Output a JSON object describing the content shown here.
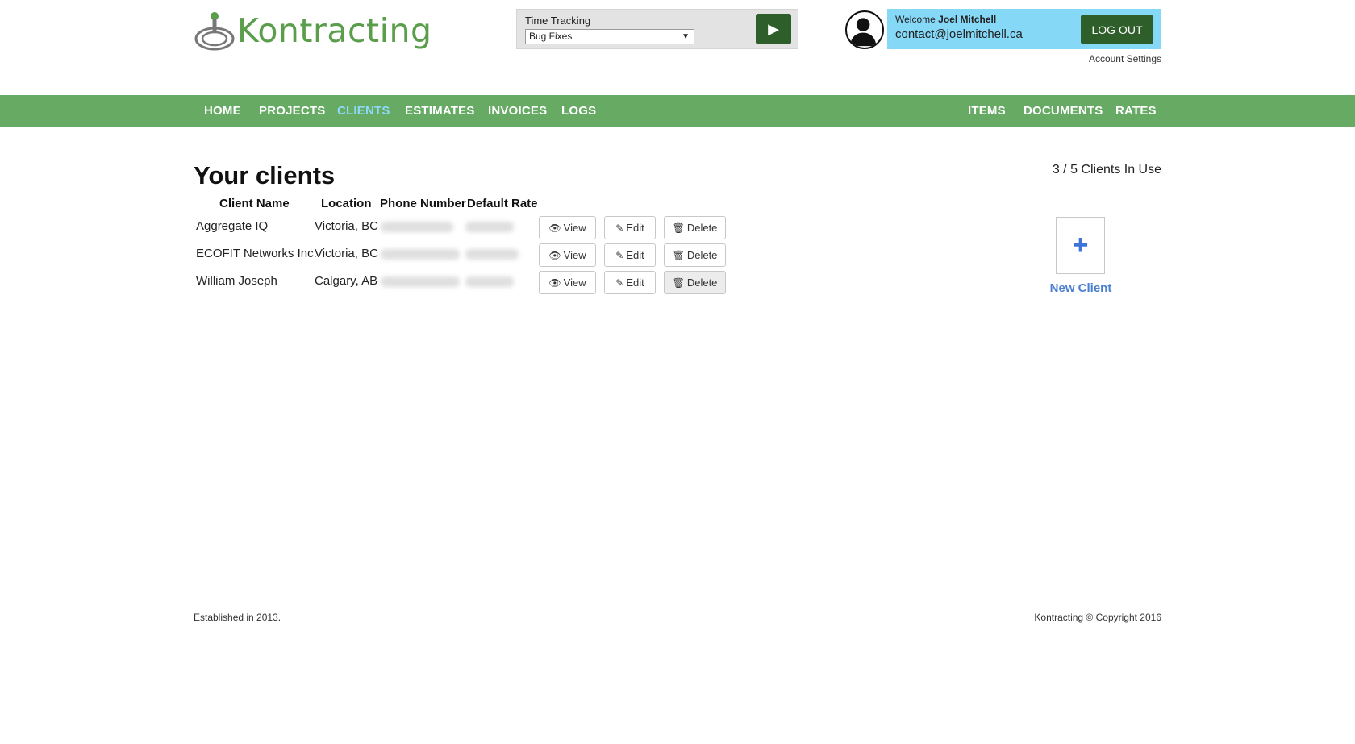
{
  "brand": {
    "name": "Kontracting"
  },
  "time_tracking": {
    "label": "Time Tracking",
    "selected": "Bug Fixes",
    "play_icon": "play-icon"
  },
  "user": {
    "welcome": "Welcome",
    "name": "Joel Mitchell",
    "email": "contact@joelmitchell.ca",
    "logout_label": "LOG OUT",
    "account_settings": "Account Settings"
  },
  "nav": {
    "left": [
      "HOME",
      "PROJECTS",
      "CLIENTS",
      "ESTIMATES",
      "INVOICES",
      "LOGS"
    ],
    "right": [
      "ITEMS",
      "DOCUMENTS",
      "RATES"
    ],
    "active": "CLIENTS"
  },
  "main": {
    "title": "Your clients",
    "clients_in_use": "3 / 5 Clients In Use",
    "columns": [
      "Client Name",
      "Location",
      "Phone Number",
      "Default Rate"
    ],
    "rows": [
      {
        "name": "Aggregate IQ",
        "location": "Victoria, BC"
      },
      {
        "name": "ECOFIT Networks Inc.",
        "location": "Victoria, BC"
      },
      {
        "name": "William Joseph",
        "location": "Calgary, AB"
      }
    ],
    "buttons": {
      "view": "View",
      "edit": "Edit",
      "delete": "Delete"
    },
    "new_client": {
      "label": "New Client",
      "icon": "plus-icon"
    }
  },
  "footer": {
    "left": "Established in 2013.",
    "right": "Kontracting © Copyright 2016"
  },
  "colors": {
    "nav_green": "#66aa64",
    "dark_green": "#2e5e2a",
    "active_nav": "#8fd8f7",
    "userbox_blue": "#86d8f7",
    "link_blue": "#4b7fcf"
  }
}
